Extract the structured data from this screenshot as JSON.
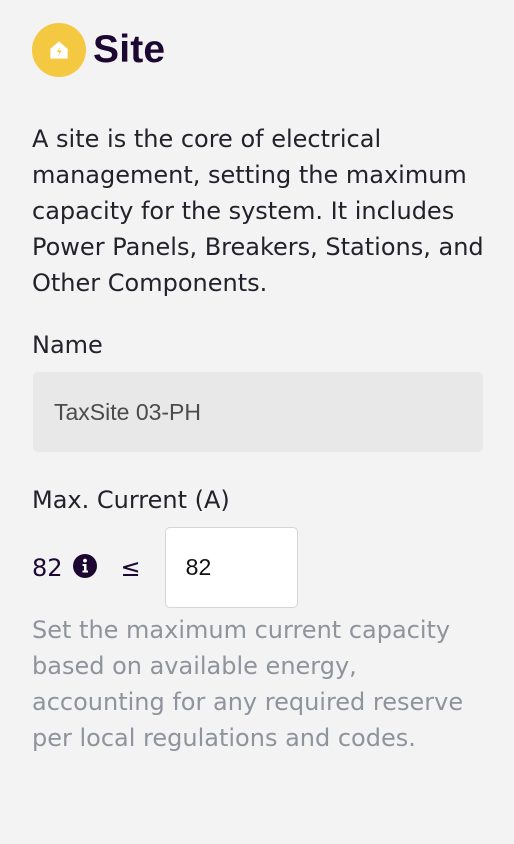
{
  "header": {
    "title": "Site",
    "icon": "home-bolt-icon",
    "icon_bg": "#f5c842"
  },
  "description": "A site is the core of electrical management, setting the maximum capacity for the system. It includes Power Panels, Breakers, Stations, and Other Components.",
  "name_field": {
    "label": "Name",
    "value": "TaxSite 03-PH"
  },
  "current_field": {
    "label": "Max. Current (A)",
    "max_value": "82",
    "info_icon": "info-icon",
    "comparator": "≤",
    "value": "82",
    "help_text": "Set the maximum current capacity based on available energy, accounting for any required reserve per local regulations and codes."
  },
  "colors": {
    "background": "#f3f3f3",
    "title": "#1c0733",
    "muted_text": "#8f939c"
  }
}
